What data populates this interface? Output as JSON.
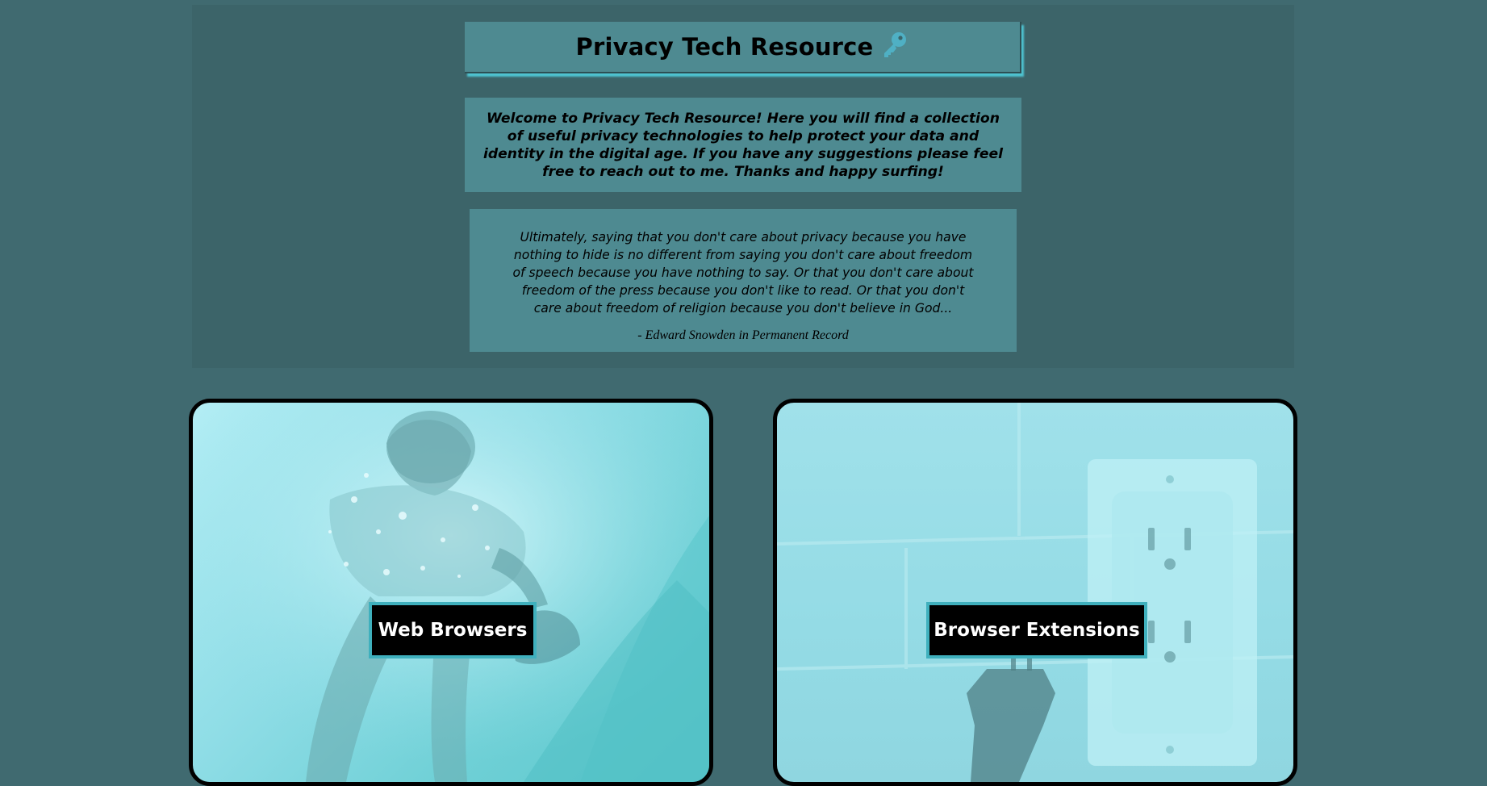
{
  "header": {
    "title": "Privacy Tech Resource",
    "title_icon": "key-icon",
    "welcome": "Welcome to Privacy Tech Resource! Here you will find a collection of useful privacy technologies to help protect your data and identity in the digital age. If you have any suggestions please feel free to reach out to me. Thanks and happy surfing!"
  },
  "quote": {
    "text": "Ultimately, saying that you don't care about privacy because you have nothing to hide is no different from saying you don't care about freedom of speech because you have nothing to say. Or that you don't care about freedom of the press because you don't like to read. Or that you don't care about freedom of religion because you don't believe in God...",
    "attribution": "- Edward Snowden in Permanent Record"
  },
  "cards": [
    {
      "label": "Web Browsers",
      "image": "surfer-in-wave"
    },
    {
      "label": "Browser Extensions",
      "image": "wall-outlet-and-plug"
    }
  ],
  "colors": {
    "page_bg": "#406a70",
    "panel_bg": "#3c6469",
    "box_bg": "#4e8a91",
    "accent": "#3fb0bd",
    "key_icon": "#4fb0c4"
  }
}
